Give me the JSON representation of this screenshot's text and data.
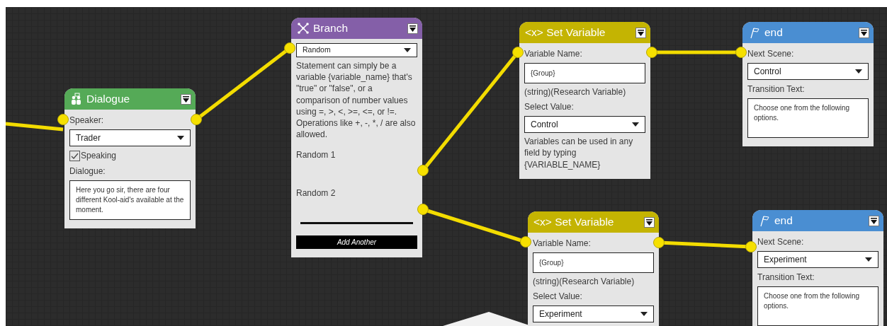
{
  "nodes": [
    {
      "kind": "dialogue",
      "title": "Dialogue",
      "color": "#55aa57",
      "fields": [
        {
          "kind": "label",
          "text": "Speaker:"
        },
        {
          "kind": "select",
          "value": "Trader"
        },
        {
          "kind": "checkbox",
          "text": "Speaking",
          "checked": true
        },
        {
          "kind": "label",
          "text": "Dialogue:"
        },
        {
          "kind": "textarea",
          "value": "Here you go sir, there are four different Kool-aid's available at the moment."
        }
      ]
    },
    {
      "kind": "branch",
      "title": "Branch",
      "color": "#845fa8",
      "fields": [
        {
          "kind": "select",
          "value": "Random",
          "small": true
        },
        {
          "kind": "text",
          "text": "Statement can simply be a variable {variable_name} that's \"true\" or \"false\", or a comparison of number values using =, >, <, >=, <=, or !=. Operations like +, -, *, / are also allowed."
        },
        {
          "kind": "option",
          "text": "Random 1"
        },
        {
          "kind": "option",
          "text": "Random 2"
        },
        {
          "kind": "divider"
        },
        {
          "kind": "button",
          "text": "Add Another"
        }
      ]
    },
    {
      "kind": "setvar",
      "title": "<x> Set Variable",
      "color": "#c4b402",
      "fields": [
        {
          "kind": "label",
          "text": "Variable Name:"
        },
        {
          "kind": "input",
          "value": "{Group}"
        },
        {
          "kind": "text",
          "text": "(string)(Research Variable)"
        },
        {
          "kind": "label",
          "text": "Select Value:"
        },
        {
          "kind": "select",
          "value": "Control"
        },
        {
          "kind": "text",
          "text": "Variables can be used in any field by typing {VARIABLE_NAME}"
        }
      ]
    },
    {
      "kind": "end",
      "title": "end",
      "color": "#4a8ed2",
      "fields": [
        {
          "kind": "label",
          "text": "Next Scene:"
        },
        {
          "kind": "select",
          "value": "Control"
        },
        {
          "kind": "label",
          "text": "Transition Text:"
        },
        {
          "kind": "textarea",
          "value": "Choose one from the following options."
        }
      ]
    },
    {
      "kind": "setvar",
      "title": "<x> Set Variable",
      "color": "#c4b402",
      "fields": [
        {
          "kind": "label",
          "text": "Variable Name:"
        },
        {
          "kind": "input",
          "value": "{Group}"
        },
        {
          "kind": "text",
          "text": "(string)(Research Variable)"
        },
        {
          "kind": "label",
          "text": "Select Value:"
        },
        {
          "kind": "select",
          "value": "Experiment"
        }
      ]
    },
    {
      "kind": "end",
      "title": "end",
      "color": "#4a8ed2",
      "fields": [
        {
          "kind": "label",
          "text": "Next Scene:"
        },
        {
          "kind": "select",
          "value": "Experiment"
        },
        {
          "kind": "label",
          "text": "Transition Text:"
        },
        {
          "kind": "textarea",
          "value": "Choose one from the following options."
        }
      ]
    }
  ]
}
